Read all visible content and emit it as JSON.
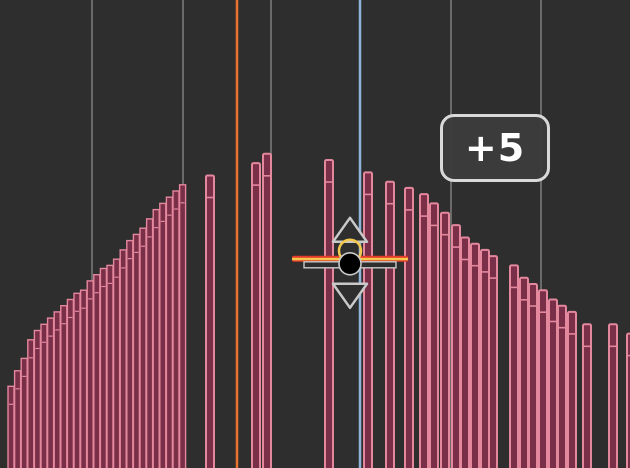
{
  "editor": {
    "view": "note-velocity-editor",
    "velocity_change_tooltip": "+5",
    "colors": {
      "background": "#2e2e2e",
      "grid_line": "#6a6a6a",
      "velocity_bar_fill": "#7a2f48",
      "velocity_bar_outline": "#e4889e",
      "playhead_orange": "#e8732c",
      "cursor_blue": "#8fb4d9",
      "handle_fill": "#2e2e2e",
      "handle_stroke": "#c9c9c9",
      "selected_line_red": "#e53b2a",
      "selected_line_yellow": "#f2c94c"
    },
    "velocity_range": [
      0,
      127
    ],
    "dense_velocities_left": [
      27,
      32,
      36,
      42,
      45,
      47,
      49,
      51,
      53,
      55,
      57,
      58,
      61,
      63,
      65,
      66,
      68,
      71,
      74,
      76,
      78,
      81,
      84,
      86,
      88,
      90,
      92
    ],
    "note_velocities": [
      95,
      99,
      102,
      100,
      96,
      93,
      91,
      89,
      86,
      83,
      79,
      75,
      73,
      71,
      69,
      66,
      62,
      60,
      58,
      55,
      53,
      51,
      47,
      47,
      44
    ],
    "selected_note_velocity": 72,
    "velocity_adjust_handle": {
      "up_arrow_icon": "triangle-up-icon",
      "down_arrow_icon": "triangle-down-icon",
      "grip_icon": "circle-grip-icon"
    }
  }
}
